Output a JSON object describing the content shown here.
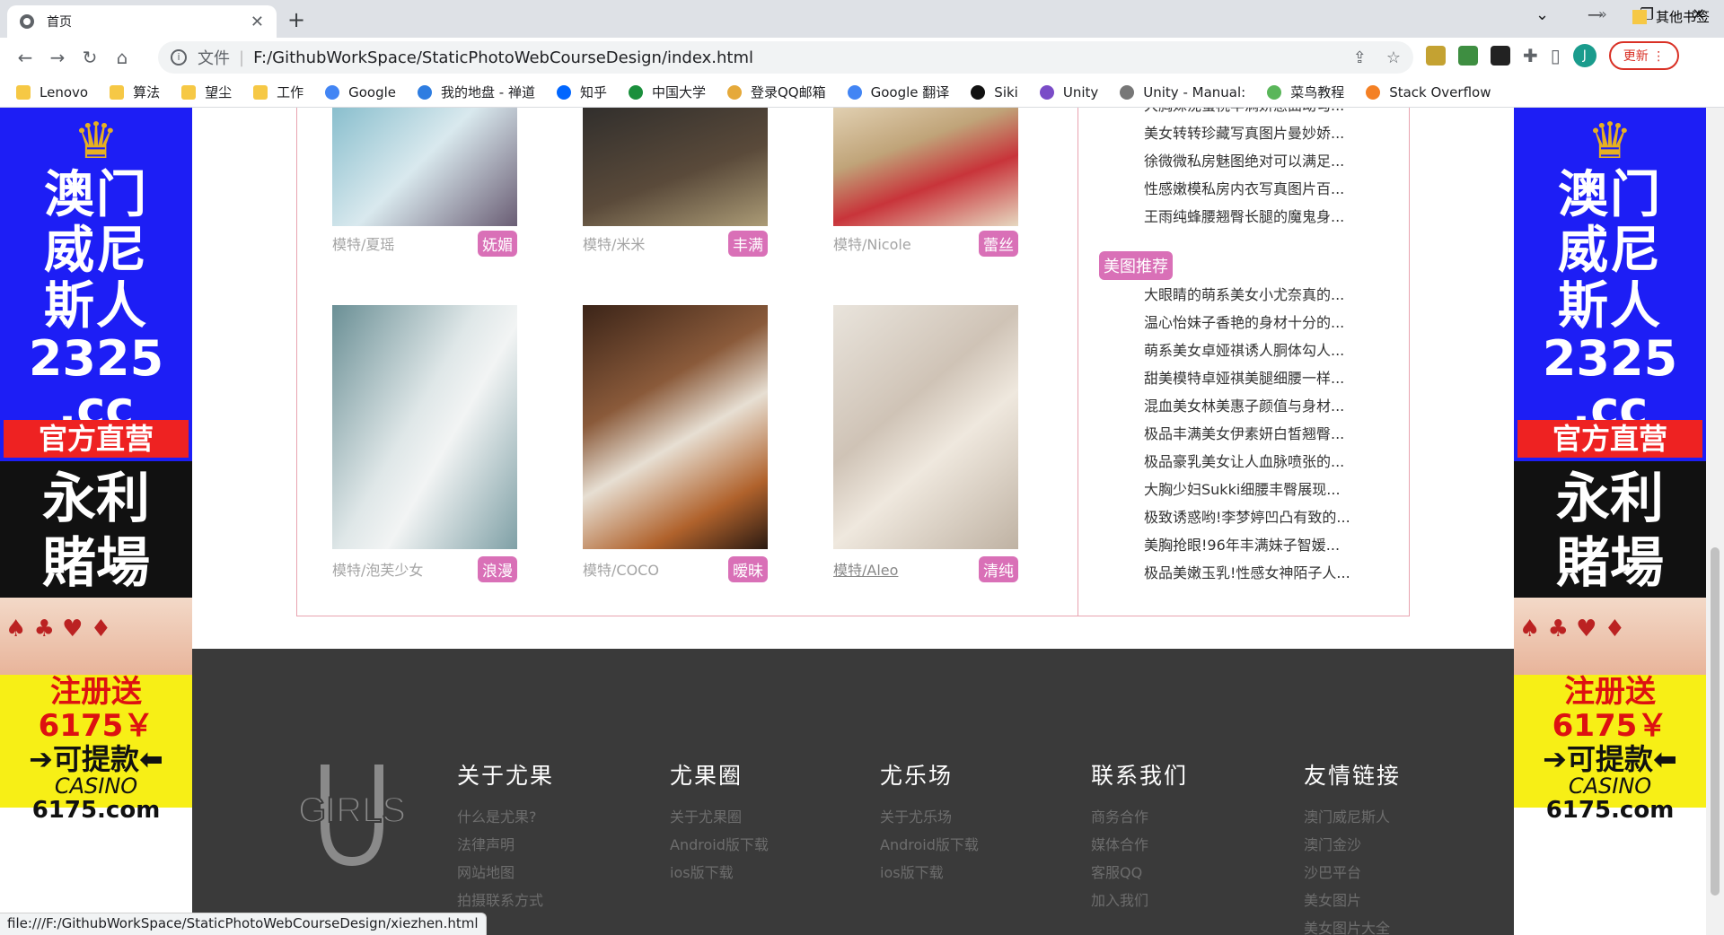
{
  "browser": {
    "tab_title": "首页",
    "tab_close": "✕",
    "new_tab": "+",
    "address_scheme": "文件",
    "address_url": "F:/GithubWorkSpace/StaticPhotoWebCourseDesign/index.html",
    "update_label": "更新",
    "avatar_letter": "J",
    "status_url": "file:///F:/GithubWorkSpace/StaticPhotoWebCourseDesign/xiezhen.html"
  },
  "bookmarks": [
    {
      "label": "Lenovo",
      "icon": "folder-icon"
    },
    {
      "label": "算法",
      "icon": "folder-icon"
    },
    {
      "label": "望尘",
      "icon": "folder-icon"
    },
    {
      "label": "工作",
      "icon": "folder-icon"
    },
    {
      "label": "Google",
      "icon": "google-icon"
    },
    {
      "label": "我的地盘 - 禅道",
      "icon": "zentao-icon"
    },
    {
      "label": "知乎",
      "icon": "zhihu-icon"
    },
    {
      "label": "中国大学",
      "icon": "mooc-icon"
    },
    {
      "label": "登录QQ邮箱",
      "icon": "qq-icon"
    },
    {
      "label": "Google 翻译",
      "icon": "translate-icon"
    },
    {
      "label": "Siki",
      "icon": "siki-icon"
    },
    {
      "label": "Unity",
      "icon": "unity-icon"
    },
    {
      "label": "Unity - Manual:",
      "icon": "unity-manual-icon"
    },
    {
      "label": "菜鸟教程",
      "icon": "runoob-icon"
    },
    {
      "label": "Stack Overflow",
      "icon": "stackoverflow-icon"
    }
  ],
  "bookmarks_more": "»",
  "bookmarks_other": "其他书签",
  "ads": {
    "top_line1": "澳门",
    "top_line2": "威尼",
    "top_line3": "斯人",
    "number": "2325",
    "domain": ".cc",
    "official": "官方直营",
    "mid_line1": "永利",
    "mid_line2": "賭場",
    "register": "注册送6175￥",
    "withdraw": "➔可提款⬅",
    "casino": "CASINO",
    "url": "6175.com"
  },
  "photos": [
    {
      "model": "模特/夏瑶",
      "tag": "妩媚"
    },
    {
      "model": "模特/米米",
      "tag": "丰满"
    },
    {
      "model": "模特/Nicole",
      "tag": "蕾丝"
    },
    {
      "model": "模特/泡芙少女",
      "tag": "浪漫"
    },
    {
      "model": "模特/COCO",
      "tag": "暧昧"
    },
    {
      "model": "模特/Aleo",
      "tag": "清纯"
    }
  ],
  "sidebar_top": [
    "大胸妹沈蜜桃丰满娇惑曲动勾...",
    "美女转转珍藏写真图片曼妙娇...",
    "徐微微私房魅图绝对可以满足...",
    "性感嫩模私房内衣写真图片百...",
    "王雨纯蜂腰翘臀长腿的魔鬼身..."
  ],
  "recommend_title": "美图推荐",
  "recommend": [
    "大眼睛的萌系美女小尤奈真的...",
    "温心怡妹子香艳的身材十分的...",
    "萌系美女卓娅祺诱人胴体勾人...",
    "甜美模特卓娅祺美腿细腰一样...",
    "混血美女林美惠子颜值与身材...",
    "极品丰满美女伊素妍白皙翘臀...",
    "极品豪乳美女让人血脉喷张的...",
    "大胸少妇Sukki细腰丰臀展现...",
    "极致诱惑哟!李梦婷凹凸有致的...",
    "美胸抢眼!96年丰满妹子智媛...",
    "极品美嫩玉乳!性感女神陌子人..."
  ],
  "footer": {
    "logo_text": "GIRLS",
    "columns": [
      {
        "title": "关于尤果",
        "links": [
          "什么是尤果?",
          "法律声明",
          "网站地图",
          "拍摄联系方式"
        ]
      },
      {
        "title": "尤果圈",
        "links": [
          "关于尤果圈",
          "Android版下载",
          "ios版下载"
        ]
      },
      {
        "title": "尤乐场",
        "links": [
          "关于尤乐场",
          "Android版下载",
          "ios版下载"
        ]
      },
      {
        "title": "联系我们",
        "links": [
          "商务合作",
          "媒体合作",
          "客服QQ",
          "加入我们"
        ]
      },
      {
        "title": "友情链接",
        "links": [
          "澳门威尼斯人",
          "澳门金沙",
          "沙巴平台",
          "美女图片",
          "美女图片大全"
        ]
      }
    ]
  },
  "colors": {
    "accent_pink": "#d970b7",
    "frame_border": "#e8a3b0",
    "footer_bg": "#3a3a3a",
    "ad_blue": "#1d1ef5",
    "ad_yellow": "#f7ef16"
  }
}
